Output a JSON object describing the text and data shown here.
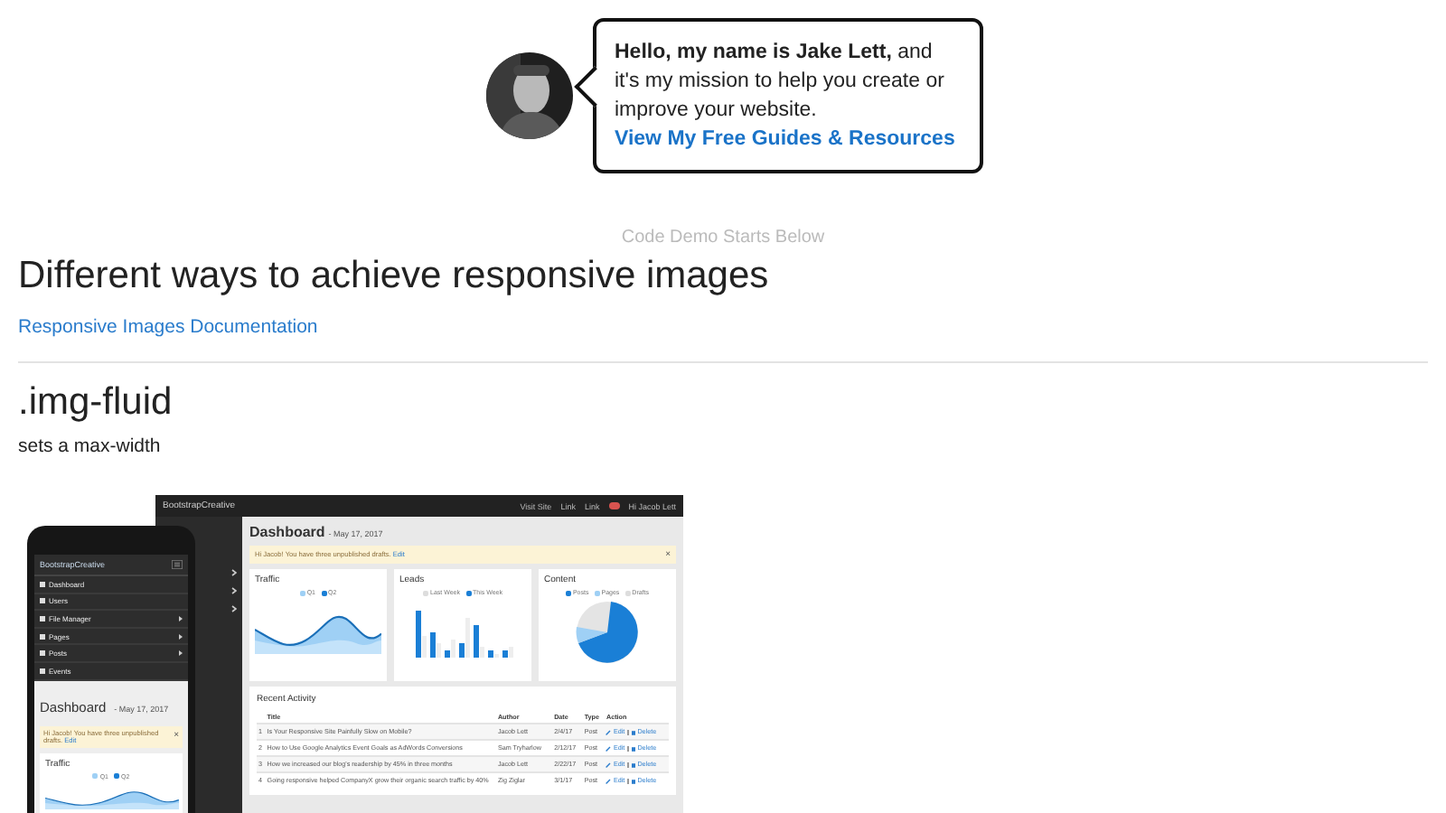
{
  "promo": {
    "intro": "**Hello, my name is Jake Lett,** and it's my mission to help you create or improve your website.",
    "link": "View My Free Guides & Resources"
  },
  "demo_note": "Code Demo Starts Below",
  "heading": "Different ways to achieve responsive images",
  "doc_link": "Responsive Images Documentation",
  "section": {
    "title": ".img-fluid",
    "description": "sets a max-width"
  },
  "desktop": {
    "brand": "BootstrapCreative",
    "nav_links": [
      "Visit Site",
      "Link",
      "Link"
    ],
    "user": "Hi Jacob Lett",
    "page_title": "Dashboard",
    "date": "- May 17, 2017",
    "alert": {
      "text": "Hi Jacob! You have three unpublished drafts.",
      "link": "Edit",
      "close": "×"
    },
    "cards": [
      {
        "title": "Traffic",
        "kind": "area",
        "legend": [
          {
            "label": "Q1",
            "color": "#9fd0f5"
          },
          {
            "label": "Q2",
            "color": "#1a7fd6"
          }
        ]
      },
      {
        "title": "Leads",
        "kind": "bar",
        "legend": [
          {
            "label": "Last Week",
            "color": "#dddddd"
          },
          {
            "label": "This Week",
            "color": "#1a7fd6"
          }
        ]
      },
      {
        "title": "Content",
        "kind": "pie",
        "legend": [
          {
            "label": "Posts",
            "color": "#1a7fd6"
          },
          {
            "label": "Pages",
            "color": "#9fd0f5"
          },
          {
            "label": "Drafts",
            "color": "#dddddd"
          }
        ]
      }
    ],
    "activity": {
      "title": "Recent Activity",
      "columns": [
        "Title",
        "Author",
        "Date",
        "Type",
        "Action"
      ],
      "rows": [
        {
          "num": "1",
          "title": "Is Your Responsive Site Painfully Slow on Mobile?",
          "author": "Jacob Lett",
          "date": "2/4/17",
          "type": "Post",
          "edit": "Edit",
          "delete": "Delete"
        },
        {
          "num": "2",
          "title": "How to Use Google Analytics Event Goals as AdWords Conversions",
          "author": "Sam Tryharlow",
          "date": "2/12/17",
          "type": "Post",
          "edit": "Edit",
          "delete": "Delete"
        },
        {
          "num": "3",
          "title": "How we increased our blog's readership by 45% in three months",
          "author": "Jacob Lett",
          "date": "2/22/17",
          "type": "Post",
          "edit": "Edit",
          "delete": "Delete"
        },
        {
          "num": "4",
          "title": "Going responsive helped CompanyX grow their organic search traffic by 40%",
          "author": "Zig Ziglar",
          "date": "3/1/17",
          "type": "Post",
          "edit": "Edit",
          "delete": "Delete"
        }
      ]
    }
  },
  "phone": {
    "brand": "BootstrapCreative",
    "menu": [
      {
        "label": "Dashboard",
        "expandable": false
      },
      {
        "label": "Users",
        "expandable": false
      },
      {
        "label": "File Manager",
        "expandable": true
      },
      {
        "label": "Pages",
        "expandable": true
      },
      {
        "label": "Posts",
        "expandable": true
      },
      {
        "label": "Events",
        "expandable": false
      }
    ],
    "page_title": "Dashboard",
    "date": "- May 17, 2017",
    "alert": {
      "text": "Hi Jacob! You have three unpublished drafts.",
      "link": "Edit",
      "close": "×"
    },
    "card": {
      "title": "Traffic",
      "legend": [
        {
          "label": "Q1",
          "color": "#9fd0f5"
        },
        {
          "label": "Q2",
          "color": "#1a7fd6"
        }
      ]
    }
  }
}
